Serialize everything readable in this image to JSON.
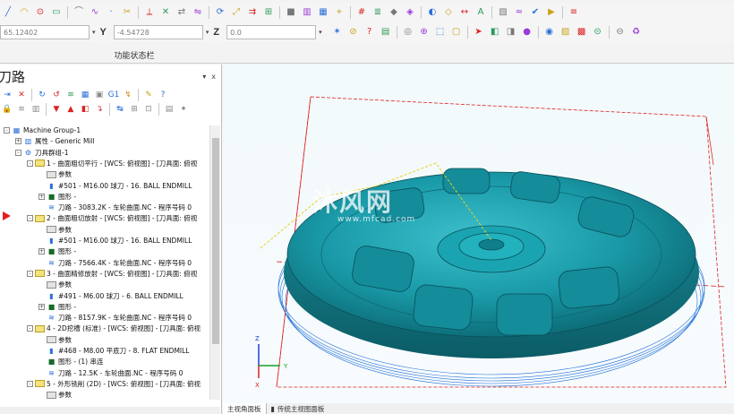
{
  "toolbar": {
    "row1_icons": [
      "line-icon",
      "arc-icon",
      "circle-icon",
      "rectangle-icon",
      "fillet-icon",
      "spline-icon",
      "point-icon",
      "trim-icon",
      "break-icon",
      "delete-icon",
      "transform-icon",
      "mirror-icon",
      "rotate-icon",
      "scale-icon",
      "offset-icon",
      "array-icon",
      "solid-icon",
      "surface-icon",
      "mesh-icon",
      "analyze-icon",
      "grid-icon",
      "layer-icon",
      "color-icon",
      "view-icon",
      "shade-icon",
      "wireframe-icon",
      "dimension-icon",
      "note-icon",
      "hatch-icon",
      "toolpath-icon",
      "verify-icon",
      "simulate-icon",
      "post-icon"
    ],
    "row2_icons": [
      "snap-icon",
      "cancel-icon",
      "help-icon",
      "clip-icon",
      "render-icon",
      "zoom-icon",
      "select-icon",
      "window-icon",
      "arrow-icon",
      "cube-icon",
      "box-icon",
      "sphere-icon",
      "globe-icon",
      "level-icon",
      "attr-icon",
      "stop-icon",
      "no-entry-icon",
      "recycle-icon"
    ]
  },
  "coords": {
    "x_value": "65.12402",
    "y_label": "Y",
    "y_value": "-4.54728",
    "z_label": "Z",
    "z_value": "0.0"
  },
  "status_bar_title": "功能状态栏",
  "panel": {
    "title": "刀路",
    "pin": "▾",
    "close": "x"
  },
  "tree": [
    {
      "indent": 0,
      "exp": "-",
      "icon": "machine",
      "text": "Machine Group-1"
    },
    {
      "indent": 1,
      "exp": "+",
      "icon": "props",
      "text": "属性 - Generic Mill"
    },
    {
      "indent": 1,
      "exp": "-",
      "icon": "group",
      "text": "刀具群组-1"
    },
    {
      "indent": 2,
      "exp": "-",
      "icon": "folder-yellow",
      "text": "1 - 曲面粗切平行 - [WCS: 俯视图] - [刀具面: 俯视"
    },
    {
      "indent": 3,
      "exp": "",
      "icon": "folder-grey",
      "text": "参数"
    },
    {
      "indent": 3,
      "exp": "",
      "icon": "tool",
      "text": "#501 - M16.00 球刀 - 16. BALL ENDMILL"
    },
    {
      "indent": 3,
      "exp": "+",
      "icon": "geom",
      "text": "图形 -"
    },
    {
      "indent": 3,
      "exp": "",
      "icon": "path",
      "text": "刀路 - 3083.2K - 车轮曲面.NC - 程序号码 0"
    },
    {
      "indent": 2,
      "exp": "-",
      "icon": "folder-yellow",
      "text": "2 - 曲面粗切放射 - [WCS: 俯视图] - [刀具面: 俯视"
    },
    {
      "indent": 3,
      "exp": "",
      "icon": "folder-grey",
      "text": "参数"
    },
    {
      "indent": 3,
      "exp": "",
      "icon": "tool",
      "text": "#501 - M16.00 球刀 - 16. BALL ENDMILL"
    },
    {
      "indent": 3,
      "exp": "+",
      "icon": "geom",
      "text": "图形 -"
    },
    {
      "indent": 3,
      "exp": "",
      "icon": "path",
      "text": "刀路 - 7566.4K - 车轮曲面.NC - 程序号码 0"
    },
    {
      "indent": 2,
      "exp": "-",
      "icon": "folder-yellow",
      "text": "3 - 曲面精修放射 - [WCS: 俯视图] - [刀具面: 俯视"
    },
    {
      "indent": 3,
      "exp": "",
      "icon": "folder-grey",
      "text": "参数"
    },
    {
      "indent": 3,
      "exp": "",
      "icon": "tool",
      "text": "#491 - M6.00 球刀 - 6. BALL ENDMILL"
    },
    {
      "indent": 3,
      "exp": "+",
      "icon": "geom",
      "text": "图形 -"
    },
    {
      "indent": 3,
      "exp": "",
      "icon": "path",
      "text": "刀路 - 8157.9K - 车轮曲面.NC - 程序号码 0"
    },
    {
      "indent": 2,
      "exp": "-",
      "icon": "folder-yellow",
      "text": "4 - 2D挖槽 (标准) - [WCS: 俯视图] - [刀具面: 俯视"
    },
    {
      "indent": 3,
      "exp": "",
      "icon": "folder-grey",
      "text": "参数"
    },
    {
      "indent": 3,
      "exp": "",
      "icon": "tool",
      "text": "#468 - M8.00 平底刀 - 8. FLAT ENDMILL"
    },
    {
      "indent": 3,
      "exp": "",
      "icon": "geom",
      "text": "图形 - (1) 串连"
    },
    {
      "indent": 3,
      "exp": "",
      "icon": "path",
      "text": "刀路 - 12.5K - 车轮曲面.NC - 程序号码 0"
    },
    {
      "indent": 2,
      "exp": "-",
      "icon": "folder-yellow",
      "text": "5 - 外形铣削 (2D) - [WCS: 俯视图] - [刀具面: 俯视"
    },
    {
      "indent": 3,
      "exp": "",
      "icon": "folder-grey",
      "text": "参数"
    }
  ],
  "tabs": {
    "tab1": "主视角面板",
    "tab2": "传统主视图面板"
  },
  "watermark": {
    "main": "沐风网",
    "sub": "www.mfcad.com"
  },
  "axis": {
    "x": "X",
    "y": "Y",
    "z": "Z"
  },
  "colors": {
    "part": "#1a9aa8",
    "part_dark": "#0d6f7a",
    "toolpath": "#1e6fd8",
    "boundary": "#e02020",
    "chain": "#e8d020"
  }
}
